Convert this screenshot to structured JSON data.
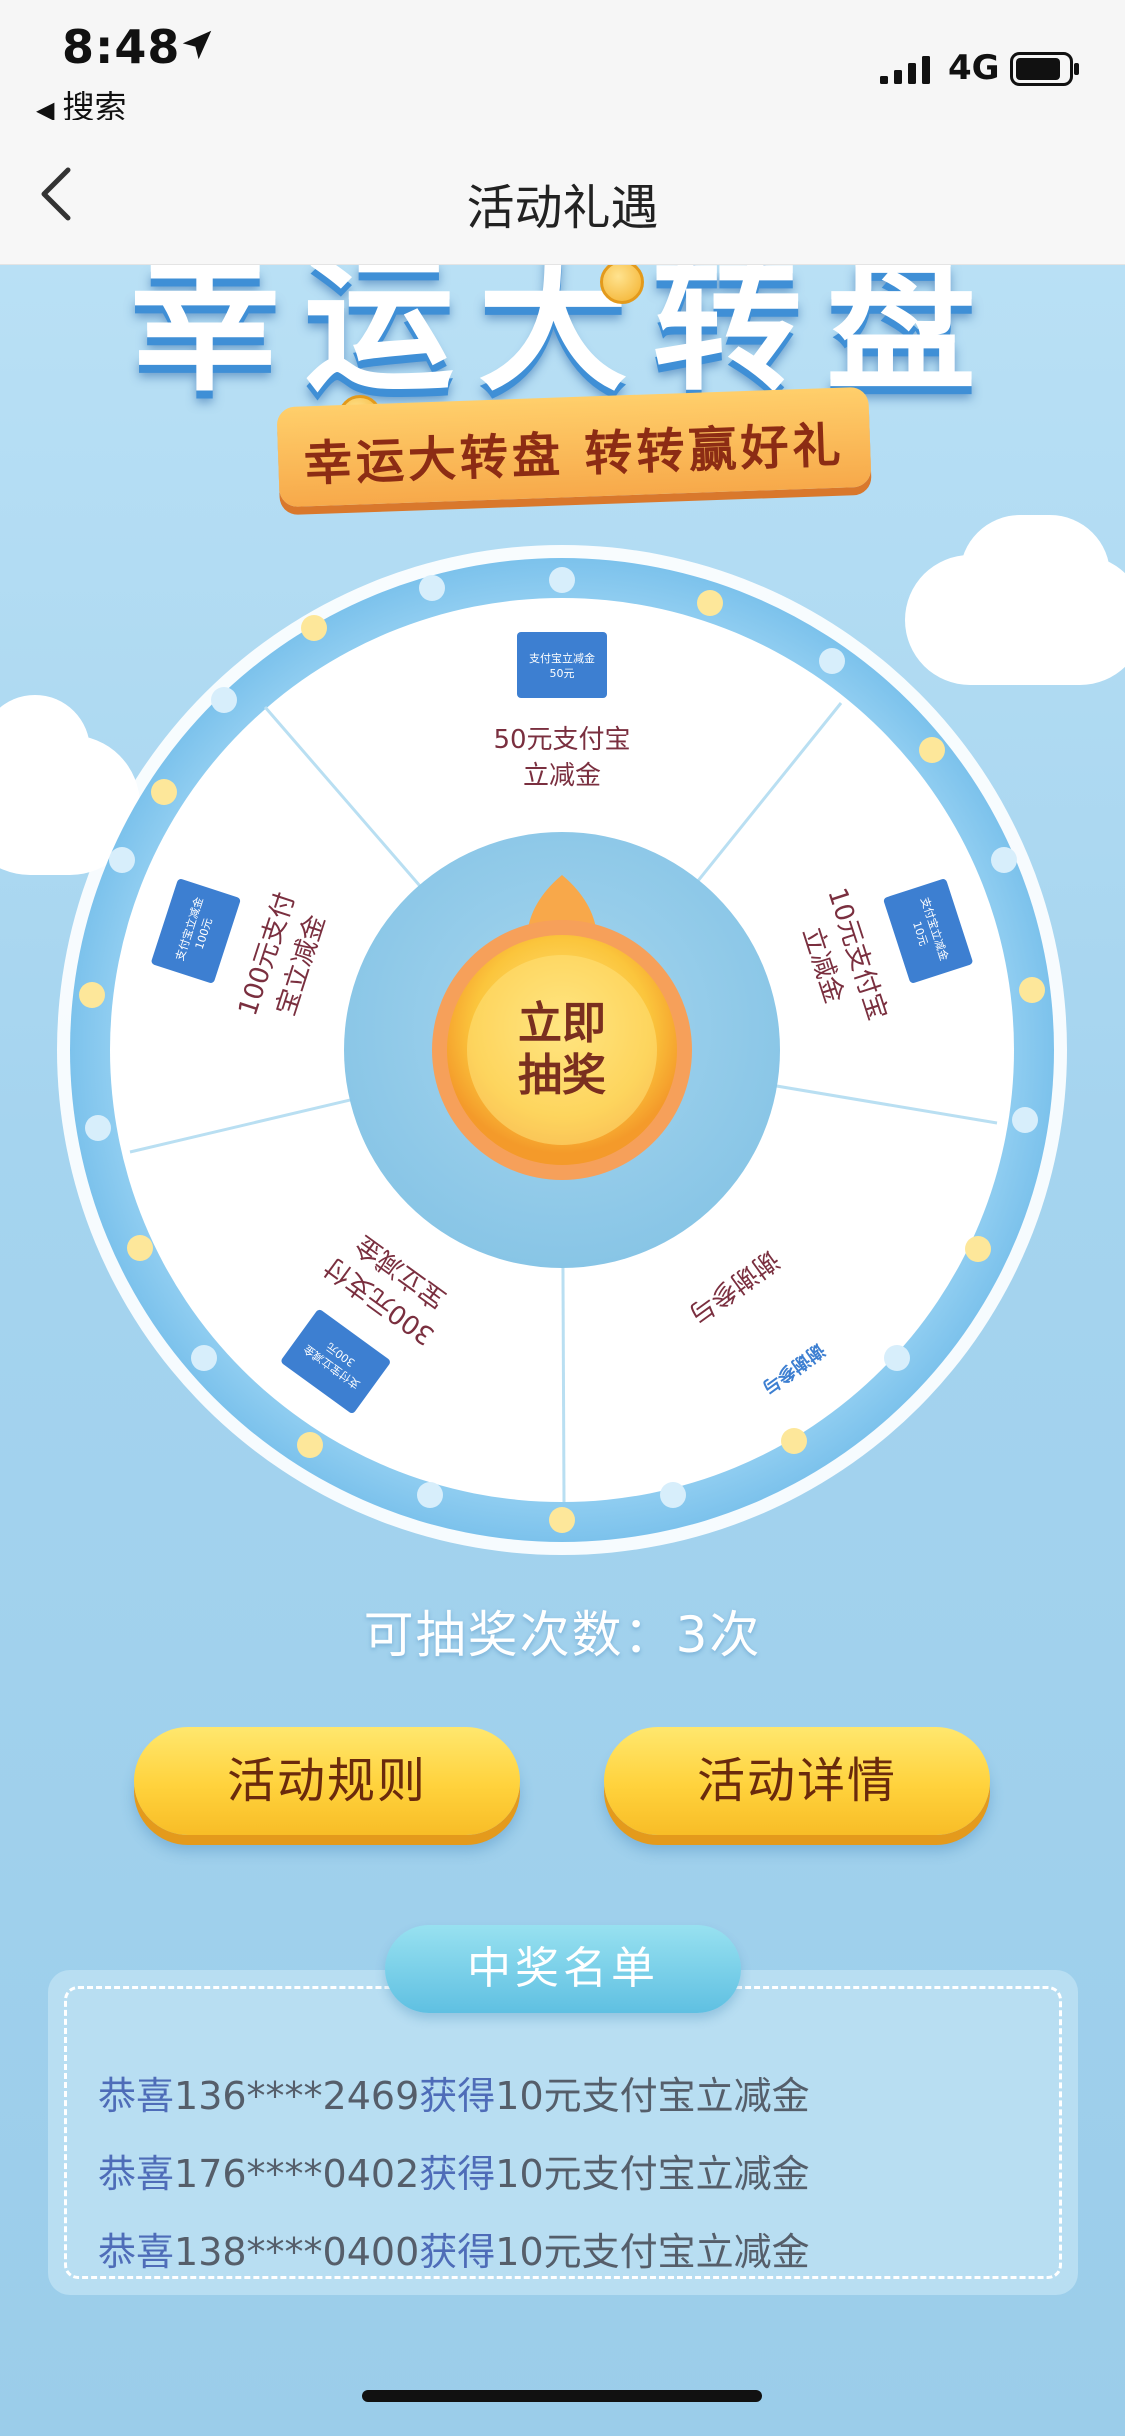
{
  "status_bar": {
    "time": "8:48",
    "back_label": "搜索",
    "network": "4G"
  },
  "nav": {
    "title": "活动礼遇"
  },
  "banner": {
    "title": "幸运大转盘",
    "subtitle": "幸运大转盘 转转赢好礼"
  },
  "wheel": {
    "center_button": [
      "立即",
      "抽奖"
    ],
    "prizes": [
      {
        "label_line1": "50元支付宝",
        "label_line2": "立减金",
        "card_text": "支付宝立减金",
        "card_amount": "50元"
      },
      {
        "label_line1": "10元支付宝",
        "label_line2": "立减金",
        "card_text": "支付宝立减金",
        "card_amount": "10元"
      },
      {
        "label_line1": "谢谢参与",
        "label_line2": "",
        "card_text": "谢谢参与",
        "card_amount": ""
      },
      {
        "label_line1": "300元支付",
        "label_line2": "宝立减金",
        "card_text": "支付宝立减金",
        "card_amount": "300元"
      },
      {
        "label_line1": "100元支付",
        "label_line2": "宝立减金",
        "card_text": "支付宝立减金",
        "card_amount": "100元"
      }
    ]
  },
  "draw_count": "可抽奖次数：3次",
  "buttons": {
    "rules": "活动规则",
    "details": "活动详情"
  },
  "winners": {
    "header": "中奖名单",
    "rows": [
      {
        "prefix": "恭喜",
        "phone": "136****2469",
        "mid": "获得",
        "prize": "10元支付宝立减金"
      },
      {
        "prefix": "恭喜",
        "phone": "176****0402",
        "mid": "获得",
        "prize": "10元支付宝立减金"
      },
      {
        "prefix": "恭喜",
        "phone": "138****0400",
        "mid": "获得",
        "prize": "10元支付宝立减金"
      }
    ]
  },
  "colors": {
    "sky": "#a7d6ef",
    "wheel_ring": "#8fcdf0",
    "button_yellow": "#ffd23c",
    "prize_text": "#7a2f3f"
  }
}
